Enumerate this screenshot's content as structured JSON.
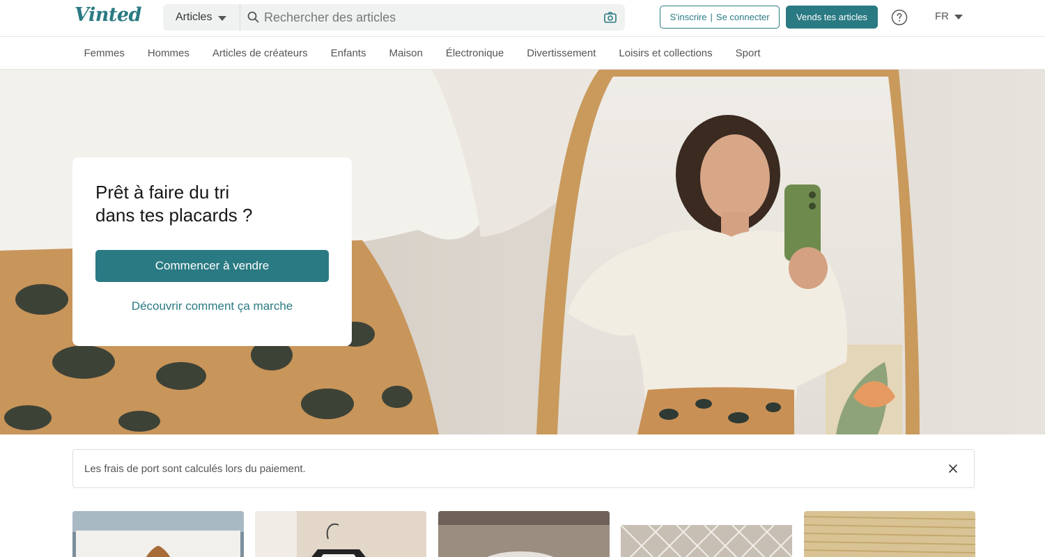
{
  "brand": {
    "logo_text": "Vinted",
    "accent": "#2a7a83"
  },
  "search": {
    "category": "Articles",
    "placeholder": "Rechercher des articles"
  },
  "header": {
    "signup_label": "S'inscrire",
    "separator": "|",
    "login_label": "Se connecter",
    "sell_label": "Vends tes articles",
    "language": "FR"
  },
  "categories": [
    "Femmes",
    "Hommes",
    "Articles de créateurs",
    "Enfants",
    "Maison",
    "Électronique",
    "Divertissement",
    "Loisirs et collections",
    "Sport"
  ],
  "hero": {
    "title_line1": "Prêt à faire du tri",
    "title_line2": "dans tes placards ?",
    "cta_label": "Commencer à vendre",
    "link_label": "Découvrir comment ça marche"
  },
  "notice": {
    "text": "Les frais de port sont calculés lors du paiement."
  },
  "icons": [
    "search-icon",
    "camera-icon",
    "help-icon",
    "chevron-down-icon",
    "close-icon"
  ]
}
